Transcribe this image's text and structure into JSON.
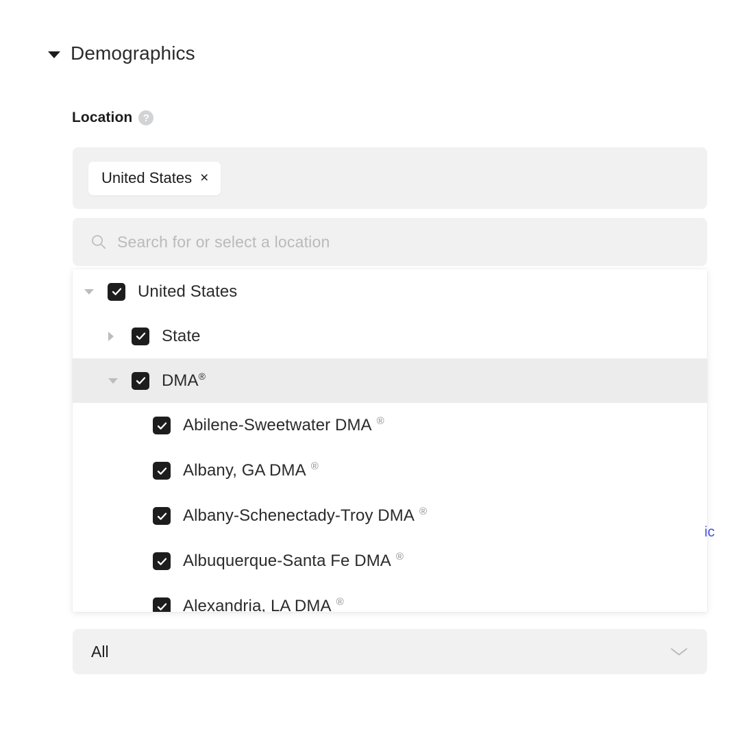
{
  "section": {
    "title": "Demographics",
    "caret_icon": "caret-down-icon",
    "expanded": true
  },
  "field": {
    "label": "Location",
    "help_icon": "help-circle-icon",
    "help_glyph": "?"
  },
  "selected_chips": [
    {
      "label": "United States",
      "remove_glyph": "×",
      "remove_icon": "close-icon"
    }
  ],
  "search": {
    "icon": "search-icon",
    "placeholder": "Search for or select a location",
    "value": ""
  },
  "tree": {
    "rows": [
      {
        "label": "United States",
        "level": 0,
        "checked": true,
        "caret": "caret-down-icon",
        "expanded": true,
        "highlighted": false,
        "registered_mark": "none"
      },
      {
        "label": "State",
        "level": 1,
        "checked": true,
        "caret": "caret-right-icon",
        "expanded": false,
        "highlighted": false,
        "registered_mark": "none"
      },
      {
        "label": "DMA",
        "level": 1,
        "checked": true,
        "caret": "caret-down-icon",
        "expanded": true,
        "highlighted": true,
        "registered_mark": "tight",
        "mark_glyph": "®"
      },
      {
        "label": "Abilene-Sweetwater DMA",
        "level": 2,
        "checked": true,
        "caret": "none",
        "highlighted": false,
        "registered_mark": "spaced",
        "mark_glyph": "®"
      },
      {
        "label": "Albany, GA DMA",
        "level": 2,
        "checked": true,
        "caret": "none",
        "highlighted": false,
        "registered_mark": "spaced",
        "mark_glyph": "®"
      },
      {
        "label": "Albany-Schenectady-Troy DMA",
        "level": 2,
        "checked": true,
        "caret": "none",
        "highlighted": false,
        "registered_mark": "spaced",
        "mark_glyph": "®"
      },
      {
        "label": "Albuquerque-Santa Fe DMA",
        "level": 2,
        "checked": true,
        "caret": "none",
        "highlighted": false,
        "registered_mark": "spaced",
        "mark_glyph": "®"
      },
      {
        "label": "Alexandria, LA DMA",
        "level": 2,
        "checked": true,
        "caret": "none",
        "highlighted": false,
        "registered_mark": "spaced",
        "mark_glyph": "®",
        "clipped": true
      }
    ]
  },
  "scope_select": {
    "value": "All",
    "chevron_icon": "chevron-down-icon"
  },
  "edge_fragment": {
    "text": "ic",
    "color": "#4355e8"
  },
  "colors": {
    "page_background": "#ffffff",
    "input_background": "#f1f1f2",
    "row_highlight": "#ececed",
    "checkbox": "#1d1d1d",
    "text_primary": "#1c1c1c",
    "text_muted": "#b9babb",
    "caret_grey": "#bcbdbe",
    "link_blue": "#4355e8"
  }
}
